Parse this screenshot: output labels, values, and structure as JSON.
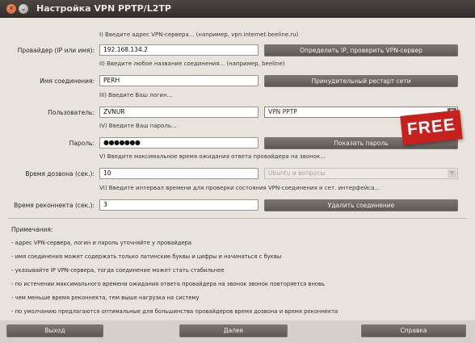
{
  "window": {
    "title": "Настройка VPN PPTP/L2TP",
    "close_glyph": "✕",
    "minimize_glyph": "⌄"
  },
  "steps": {
    "s1": "I) Введите адрес VPN-сервера... (например, vpn.internet.beeline.ru)",
    "s2": "II) Введите любое название соединения... (например, beeline)",
    "s3": "III) Введите Ваш логин...",
    "s4": "IV) Введите Ваш пароль...",
    "s5": "V) Введите максимальное время ожидания ответа провайдера на звонок...",
    "s6": "VI) Введите интервал времени для проверки состояния VPN-соединения и сет. интерфейса..."
  },
  "fields": {
    "provider": {
      "label": "Провайдер (IP или имя):",
      "value": "192.168.134.2"
    },
    "connection_name": {
      "label": "Имя соединения:",
      "value": "PERH"
    },
    "user": {
      "label": "Пользователь:",
      "value": "ZVNUR"
    },
    "password": {
      "label": "Пароль:",
      "value": "●●●●●●●"
    },
    "dial_time": {
      "label": "Время дозвона (сек.):",
      "value": "10"
    },
    "reconnect_time": {
      "label": "Время реконнекта (сек.):",
      "value": "3"
    }
  },
  "buttons": {
    "detect_ip": "Определить IP, проверить VPN-сервер",
    "force_restart": "Принудительный рестарт сети",
    "show_password": "Показать пароль",
    "delete_connection": "Удалить соединение"
  },
  "selects": {
    "vpn_type": {
      "value": "VPN PPTP",
      "arrow": "▼"
    },
    "profile": {
      "value": "Ubuntu и вопросы",
      "arrow": "▼"
    }
  },
  "notes": {
    "title": "Примечания:",
    "items": [
      "- адрес VPN-сервера, логин и пароль уточняйте у провайдера",
      "- имя соединения может содержать только латинские буквы и цифры и начинаться с буквы",
      "- указывайте IP VPN-сервера, тогда соединение может стать стабильнее",
      "- по истечении максимального времени ожидания ответа провайдера на звонок звонок повторяется вновь",
      "- чем меньше время реконнекта, тем выше нагрузка на систему",
      "- по умолчанию предлагаются оптимальные для большинства провайдеров время дозвона и время реконнекта"
    ]
  },
  "footer": {
    "exit": "Выход",
    "next": "Далее",
    "help": "Справка"
  },
  "badge": {
    "text": "FREE",
    "color": "#c8201c"
  }
}
